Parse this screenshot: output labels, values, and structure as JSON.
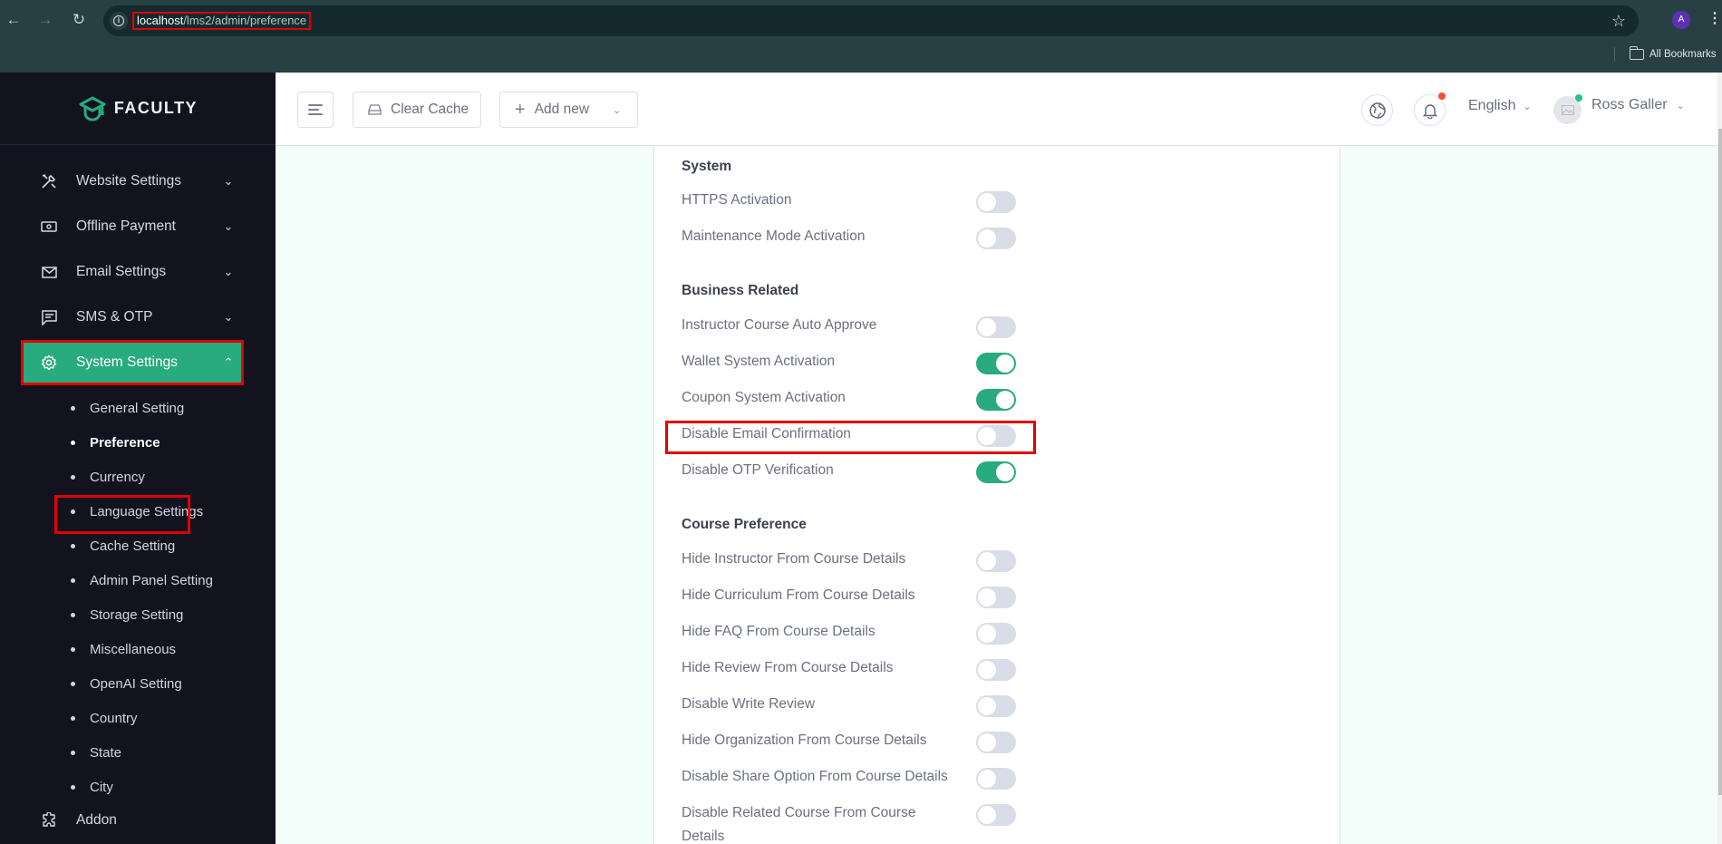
{
  "browser": {
    "url_host": "localhost",
    "url_path": "/lms2/admin/preference",
    "profile_initial": "A",
    "bookmarks_label": "All Bookmarks"
  },
  "brand": {
    "name": "FACULTY",
    "accent": "#28ab7e"
  },
  "sidebar": {
    "items": [
      {
        "label": "Website Settings",
        "icon": "tools-icon",
        "expanded": false
      },
      {
        "label": "Offline Payment",
        "icon": "money-icon",
        "expanded": false
      },
      {
        "label": "Email Settings",
        "icon": "mail-icon",
        "expanded": false
      },
      {
        "label": "SMS & OTP",
        "icon": "message-icon",
        "expanded": false
      },
      {
        "label": "System Settings",
        "icon": "gear-icon",
        "expanded": true,
        "active": true
      }
    ],
    "sub_items": [
      {
        "label": "General Setting"
      },
      {
        "label": "Preference",
        "active": true
      },
      {
        "label": "Currency"
      },
      {
        "label": "Language Settings"
      },
      {
        "label": "Cache Setting"
      },
      {
        "label": "Admin Panel Setting"
      },
      {
        "label": "Storage Setting"
      },
      {
        "label": "Miscellaneous"
      },
      {
        "label": "OpenAI Setting"
      },
      {
        "label": "Country"
      },
      {
        "label": "State"
      },
      {
        "label": "City"
      }
    ],
    "addon_label": "Addon"
  },
  "topbar": {
    "clear_cache_label": "Clear Cache",
    "add_new_label": "Add new",
    "language": "English",
    "user_name": "Ross Galler"
  },
  "preferences": {
    "sections": [
      {
        "title": "System",
        "items": [
          {
            "label": "HTTPS Activation",
            "on": false
          },
          {
            "label": "Maintenance Mode Activation",
            "on": false
          }
        ]
      },
      {
        "title": "Business Related",
        "items": [
          {
            "label": "Instructor Course Auto Approve",
            "on": false
          },
          {
            "label": "Wallet System Activation",
            "on": true
          },
          {
            "label": "Coupon System Activation",
            "on": true
          },
          {
            "label": "Disable Email Confirmation",
            "on": false
          },
          {
            "label": "Disable OTP Verification",
            "on": true
          }
        ]
      },
      {
        "title": "Course Preference",
        "items": [
          {
            "label": "Hide Instructor From Course Details",
            "on": false
          },
          {
            "label": "Hide Curriculum From Course Details",
            "on": false
          },
          {
            "label": "Hide FAQ From Course Details",
            "on": false
          },
          {
            "label": "Hide Review From Course Details",
            "on": false
          },
          {
            "label": "Disable Write Review",
            "on": false
          },
          {
            "label": "Hide Organization From Course Details",
            "on": false
          },
          {
            "label": "Disable Share Option From Course Details",
            "on": false
          },
          {
            "label": "Disable Related Course From Course Details",
            "on": false
          }
        ]
      }
    ]
  }
}
